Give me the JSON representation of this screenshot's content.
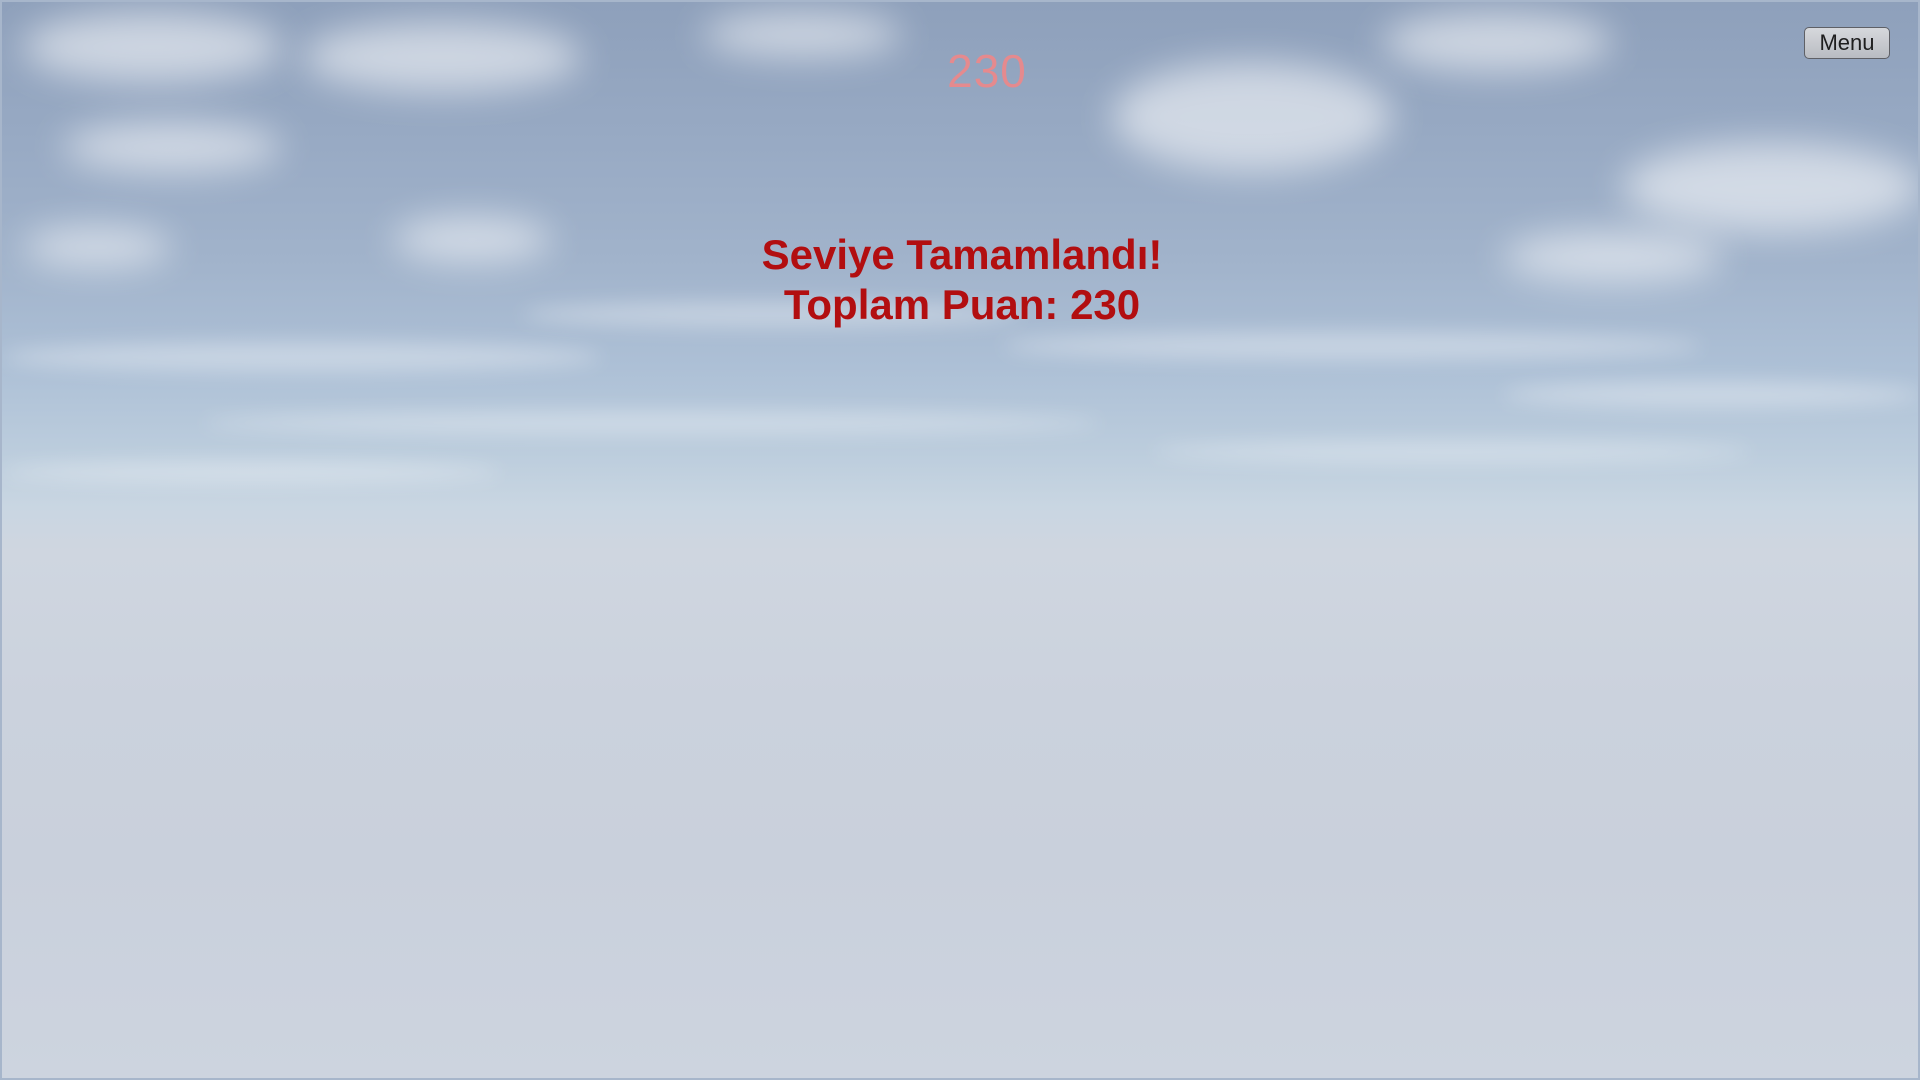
{
  "hud": {
    "score": "230",
    "menu_label": "Menu"
  },
  "level_complete": {
    "title": "Seviye Tamamlandı!",
    "total_score": "Toplam Puan: 230"
  },
  "colors": {
    "score_counter": "#e58a8e",
    "message": "#b20e10",
    "sky_top": "#8ea0bb",
    "horizon": "#c9d6e2",
    "ground_fog": "#cbd2dd"
  }
}
